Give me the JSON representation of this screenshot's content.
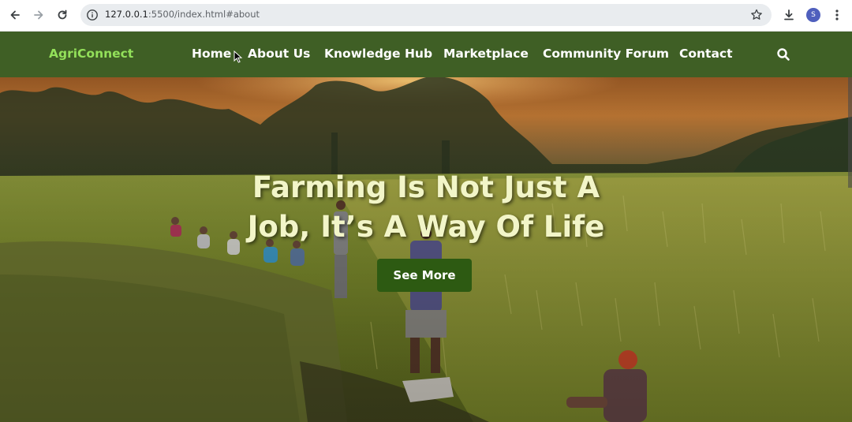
{
  "browser": {
    "url_host": "127.0.0.1",
    "url_rest": ":5500/index.html#about",
    "profile_initial": "S",
    "icons": [
      "back-icon",
      "forward-icon",
      "reload-icon",
      "site-info-icon",
      "bookmark-star-icon",
      "download-icon",
      "more-vert-icon"
    ]
  },
  "site": {
    "logo": "AgriConnect",
    "nav": {
      "home": "Home",
      "about": "About Us",
      "knowledge": "Knowledge Hub",
      "marketplace": "Marketplace",
      "forum": "Community Forum",
      "contact": "Contact"
    },
    "search_icon": "search-icon"
  },
  "hero": {
    "title_line1": "Farming Is Not Just A",
    "title_line2": "Job, It’s A Way Of Life",
    "button": "See More"
  },
  "colors": {
    "nav_bg": "#3f5f25",
    "logo": "#93e05a",
    "button_bg": "#2d5a12",
    "title_text": "#f2f5c8"
  }
}
